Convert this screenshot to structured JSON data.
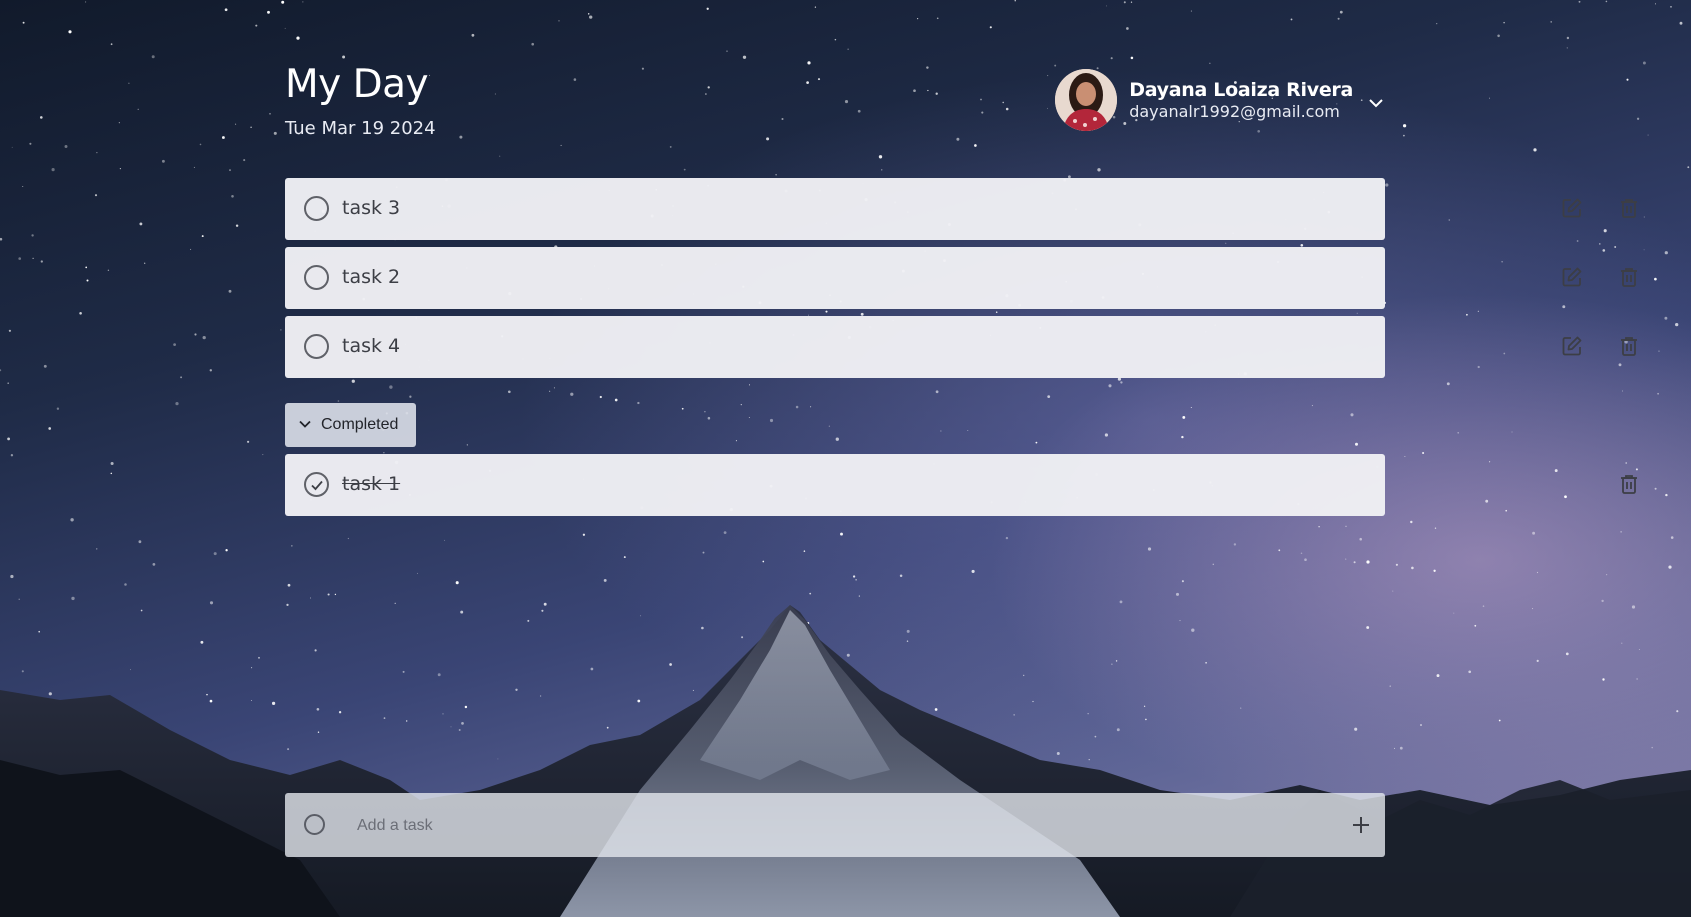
{
  "header": {
    "title": "My Day",
    "date": "Tue Mar 19 2024"
  },
  "user": {
    "name": "Dayana Loaiza Rivera",
    "email": "dayanalr1992@gmail.com"
  },
  "tasks": [
    {
      "label": "task 3"
    },
    {
      "label": "task 2"
    },
    {
      "label": "task 4"
    }
  ],
  "completed": {
    "label": "Completed",
    "items": [
      {
        "label": "task 1"
      }
    ]
  },
  "add_task": {
    "placeholder": "Add a task"
  },
  "icons": {
    "edit": "edit-icon",
    "delete": "trash-icon",
    "check": "circle-icon",
    "done": "check-circle-icon",
    "chevron": "chevron-down-icon",
    "add": "plus-icon"
  },
  "colors": {
    "task_bg": "#eff0f4",
    "completed_toggle_bg": "#d6dae4",
    "text": "#3c3e45",
    "title": "#ffffff"
  }
}
